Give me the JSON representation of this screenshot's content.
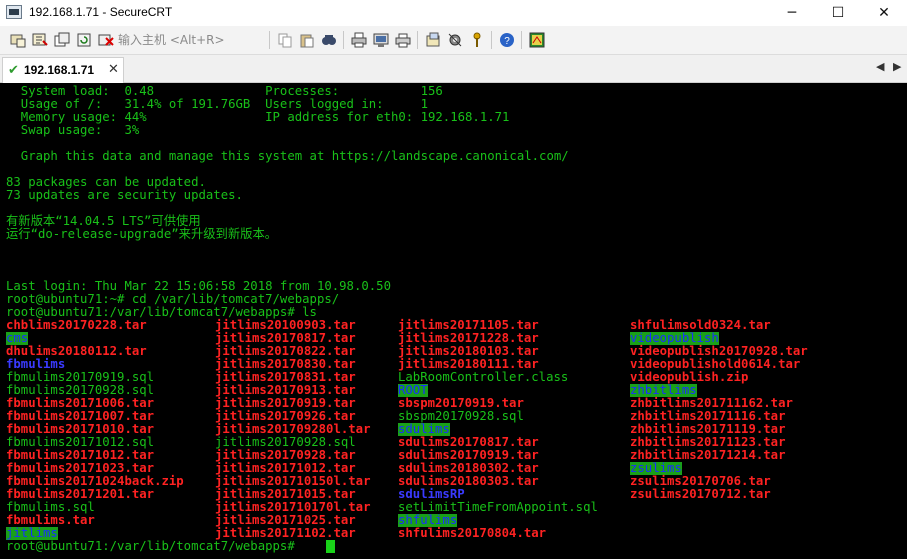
{
  "window": {
    "title": "192.168.1.71 - SecureCRT",
    "minimize_label": "─",
    "maximize_label": "☐",
    "close_label": "✕"
  },
  "toolbar": {
    "host_placeholder": "输入主机 <Alt+R>",
    "icons": [
      "connect-icon",
      "quick-connect-icon",
      "connect-tab-icon",
      "reconnect-icon",
      "disconnect-icon",
      "copy-icon",
      "paste-icon",
      "find-icon",
      "print-icon",
      "print-screen-icon",
      "print-setup-icon",
      "session-options-icon",
      "global-options-icon",
      "key-icon",
      "help-icon",
      "sftp-icon"
    ]
  },
  "tab": {
    "label": "192.168.1.71",
    "close_label": "✕",
    "prev_label": "◀",
    "next_label": "▶"
  },
  "terminal": {
    "header_lines": [
      "  System load:  0.48               Processes:           156",
      "  Usage of /:   31.4% of 191.76GB  Users logged in:     1",
      "  Memory usage: 44%                IP address for eth0: 192.168.1.71",
      "  Swap usage:   3%",
      "",
      "  Graph this data and manage this system at https://landscape.canonical.com/",
      "",
      "83 packages can be updated.",
      "73 updates are security updates.",
      "",
      "有新版本“14.04.5 LTS”可供使用",
      "运行“do-release-upgrade”来升级到新版本。",
      "",
      "",
      "",
      "Last login: Thu Mar 22 15:06:58 2018 from 10.98.0.50",
      "root@ubuntu71:~# cd /var/lib/tomcat7/webapps/",
      "root@ubuntu71:/var/lib/tomcat7/webapps# ls"
    ],
    "ls_columns": [
      [
        {
          "name": "chblims20170228.tar",
          "type": "archive"
        },
        {
          "name": "cms",
          "type": "dir"
        },
        {
          "name": "dhulims20180112.tar",
          "type": "archive"
        },
        {
          "name": "fbmulims",
          "type": "link"
        },
        {
          "name": "fbmulims20170919.sql",
          "type": "file"
        },
        {
          "name": "fbmulims20170928.sql",
          "type": "file"
        },
        {
          "name": "fbmulims20171006.tar",
          "type": "archive"
        },
        {
          "name": "fbmulims20171007.tar",
          "type": "archive"
        },
        {
          "name": "fbmulims20171010.tar",
          "type": "archive"
        },
        {
          "name": "fbmulims20171012.sql",
          "type": "file"
        },
        {
          "name": "fbmulims20171012.tar",
          "type": "archive"
        },
        {
          "name": "fbmulims20171023.tar",
          "type": "archive"
        },
        {
          "name": "fbmulims20171024back.zip",
          "type": "archive"
        },
        {
          "name": "fbmulims20171201.tar",
          "type": "archive"
        },
        {
          "name": "fbmulims.sql",
          "type": "file"
        },
        {
          "name": "fbmulims.tar",
          "type": "archive"
        },
        {
          "name": "jitlims",
          "type": "dir"
        }
      ],
      [
        {
          "name": "jitlims20100903.tar",
          "type": "archive"
        },
        {
          "name": "jitlims20170817.tar",
          "type": "archive"
        },
        {
          "name": "jitlims20170822.tar",
          "type": "archive"
        },
        {
          "name": "jitlims20170830.tar",
          "type": "archive"
        },
        {
          "name": "jitlims20170831.tar",
          "type": "archive"
        },
        {
          "name": "jitlims20170913.tar",
          "type": "archive"
        },
        {
          "name": "jitlims20170919.tar",
          "type": "archive"
        },
        {
          "name": "jitlims20170926.tar",
          "type": "archive"
        },
        {
          "name": "jitlims201709280l.tar",
          "type": "archive"
        },
        {
          "name": "jitlims20170928.sql",
          "type": "file"
        },
        {
          "name": "jitlims20170928.tar",
          "type": "archive"
        },
        {
          "name": "jitlims20171012.tar",
          "type": "archive"
        },
        {
          "name": "jitlims201710150l.tar",
          "type": "archive"
        },
        {
          "name": "jitlims20171015.tar",
          "type": "archive"
        },
        {
          "name": "jitlims201710170l.tar",
          "type": "archive"
        },
        {
          "name": "jitlims20171025.tar",
          "type": "archive"
        },
        {
          "name": "jitlims20171102.tar",
          "type": "archive"
        }
      ],
      [
        {
          "name": "jitlims20171105.tar",
          "type": "archive"
        },
        {
          "name": "jitlims20171228.tar",
          "type": "archive"
        },
        {
          "name": "jitlims20180103.tar",
          "type": "archive"
        },
        {
          "name": "jitlims20180111.tar",
          "type": "archive"
        },
        {
          "name": "LabRoomController.class",
          "type": "file"
        },
        {
          "name": "ROOT",
          "type": "dir"
        },
        {
          "name": "sbspm20170919.tar",
          "type": "archive"
        },
        {
          "name": "sbspm20170928.sql",
          "type": "file"
        },
        {
          "name": "sdulims",
          "type": "dir"
        },
        {
          "name": "sdulims20170817.tar",
          "type": "archive"
        },
        {
          "name": "sdulims20170919.tar",
          "type": "archive"
        },
        {
          "name": "sdulims20180302.tar",
          "type": "archive"
        },
        {
          "name": "sdulims20180303.tar",
          "type": "archive"
        },
        {
          "name": "sdulimsRP",
          "type": "link"
        },
        {
          "name": "setLimitTimeFromAppoint.sql",
          "type": "file"
        },
        {
          "name": "shfulims",
          "type": "dir"
        },
        {
          "name": "shfulims20170804.tar",
          "type": "archive"
        }
      ],
      [
        {
          "name": "shfulimsold0324.tar",
          "type": "archive"
        },
        {
          "name": "videopublish",
          "type": "dir"
        },
        {
          "name": "videopublish20170928.tar",
          "type": "archive"
        },
        {
          "name": "videopublishold0614.tar",
          "type": "archive"
        },
        {
          "name": "videopublish.zip",
          "type": "archive"
        },
        {
          "name": "zhbitlims",
          "type": "dir"
        },
        {
          "name": "zhbitlims201711162.tar",
          "type": "archive"
        },
        {
          "name": "zhbitlims20171116.tar",
          "type": "archive"
        },
        {
          "name": "zhbitlims20171119.tar",
          "type": "archive"
        },
        {
          "name": "zhbitlims20171123.tar",
          "type": "archive"
        },
        {
          "name": "zhbitlims20171214.tar",
          "type": "archive"
        },
        {
          "name": "zsulims",
          "type": "dir"
        },
        {
          "name": "zsulims20170706.tar",
          "type": "archive"
        },
        {
          "name": "zsulims20170712.tar",
          "type": "archive"
        }
      ]
    ],
    "prompt": "root@ubuntu71:/var/lib/tomcat7/webapps# ",
    "colors": {
      "background": "#000000",
      "text": "#19c119",
      "archive": "#ff2222",
      "link": "#3a3aff",
      "dir_bg": "#19a019",
      "dir_fg": "#1a2eff"
    }
  }
}
